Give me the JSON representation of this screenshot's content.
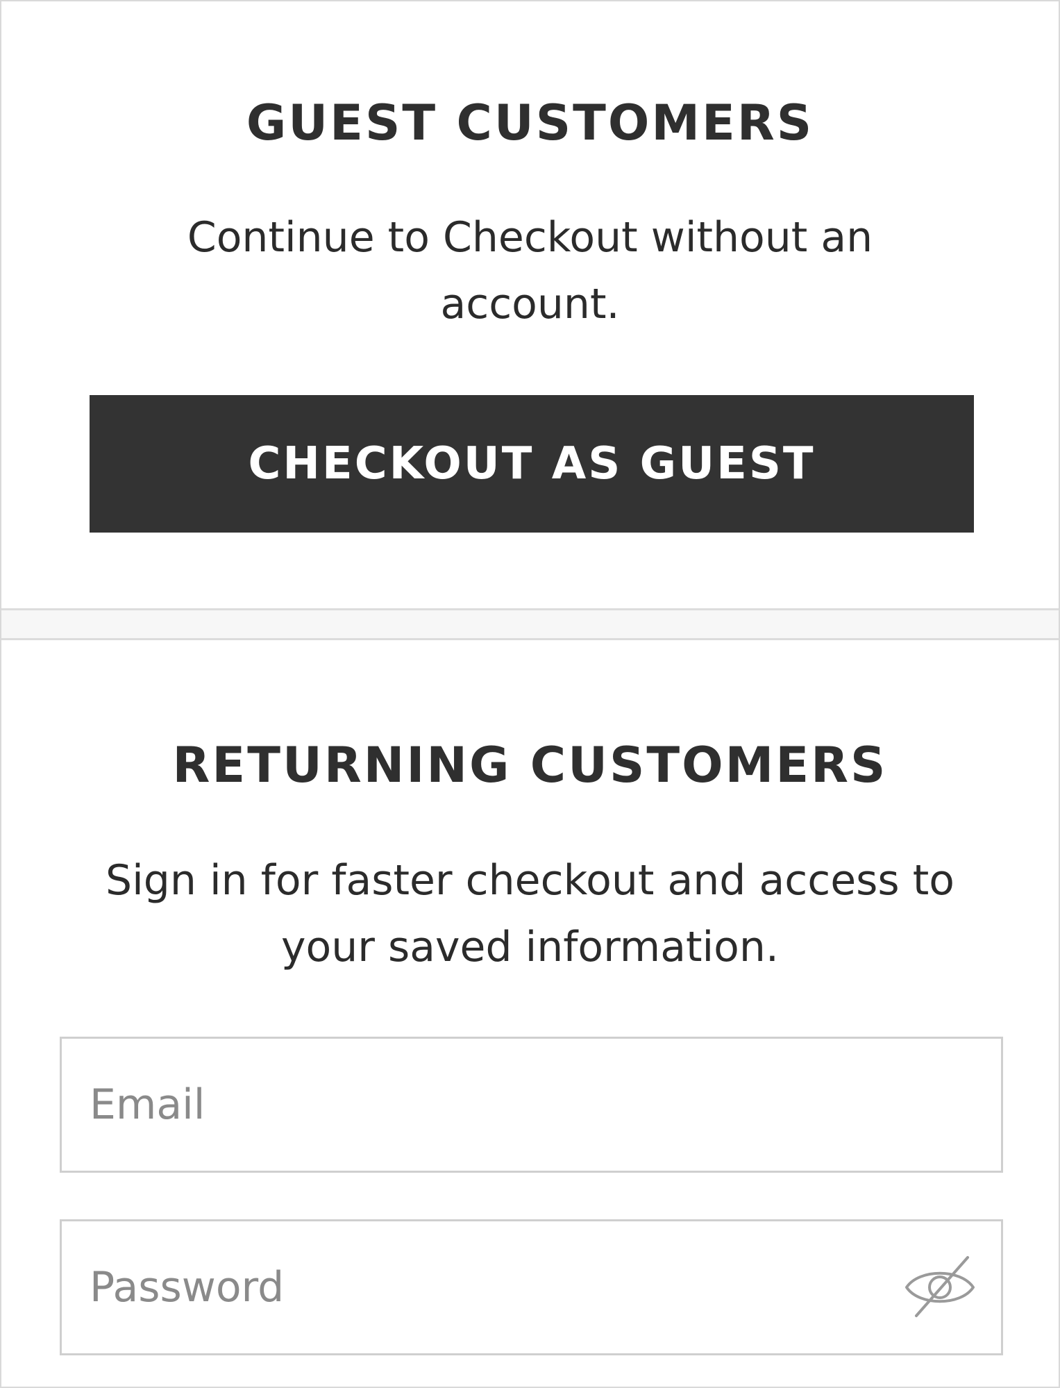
{
  "guest": {
    "heading": "GUEST CUSTOMERS",
    "description": "Continue to Checkout without an account.",
    "button_label": "CHECKOUT AS GUEST"
  },
  "returning": {
    "heading": "RETURNING CUSTOMERS",
    "description": "Sign in for faster checkout and access to your saved information.",
    "email_placeholder": "Email",
    "password_placeholder": "Password",
    "password_toggle_icon": "eye-slash-icon"
  },
  "colors": {
    "button_bg": "#333333",
    "text": "#2b2b2b",
    "placeholder": "#8a8a8a",
    "border": "#cfcfcf"
  }
}
